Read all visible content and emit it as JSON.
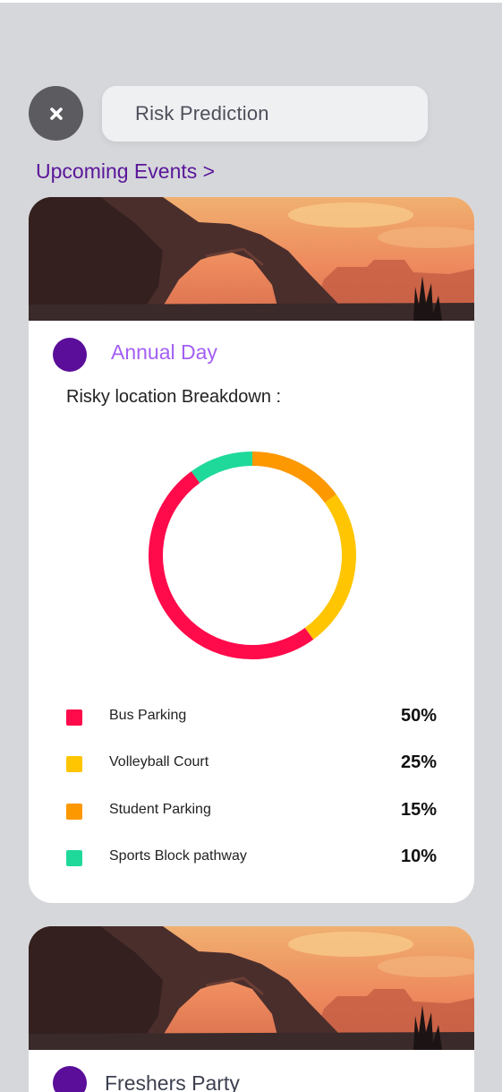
{
  "header": {
    "close_icon": "close-x-icon",
    "search_label": "Risk Prediction"
  },
  "section_link": "Upcoming Events >",
  "events": [
    {
      "title": "Annual Day",
      "breakdown_label": "Risky location Breakdown :",
      "chart_data": {
        "type": "pie",
        "labels": [
          "Bus Parking",
          "Volleyball Court",
          "Student Parking",
          "Sports Block pathway"
        ],
        "values": [
          50,
          25,
          15,
          10
        ],
        "colors": [
          "#ff0a4a",
          "#ffc500",
          "#fd9800",
          "#1fd99a"
        ]
      },
      "legend": [
        {
          "label": "Bus Parking",
          "pct": "50%"
        },
        {
          "label": "Volleyball Court",
          "pct": "25%"
        },
        {
          "label": "Student Parking",
          "pct": "15%"
        },
        {
          "label": "Sports Block pathway",
          "pct": "10%"
        }
      ]
    },
    {
      "title": "Freshers Party"
    }
  ],
  "colors": {
    "background": "#d6d7db",
    "accent_purple": "#5a1699",
    "event_title_purple": "#a35ff5"
  }
}
